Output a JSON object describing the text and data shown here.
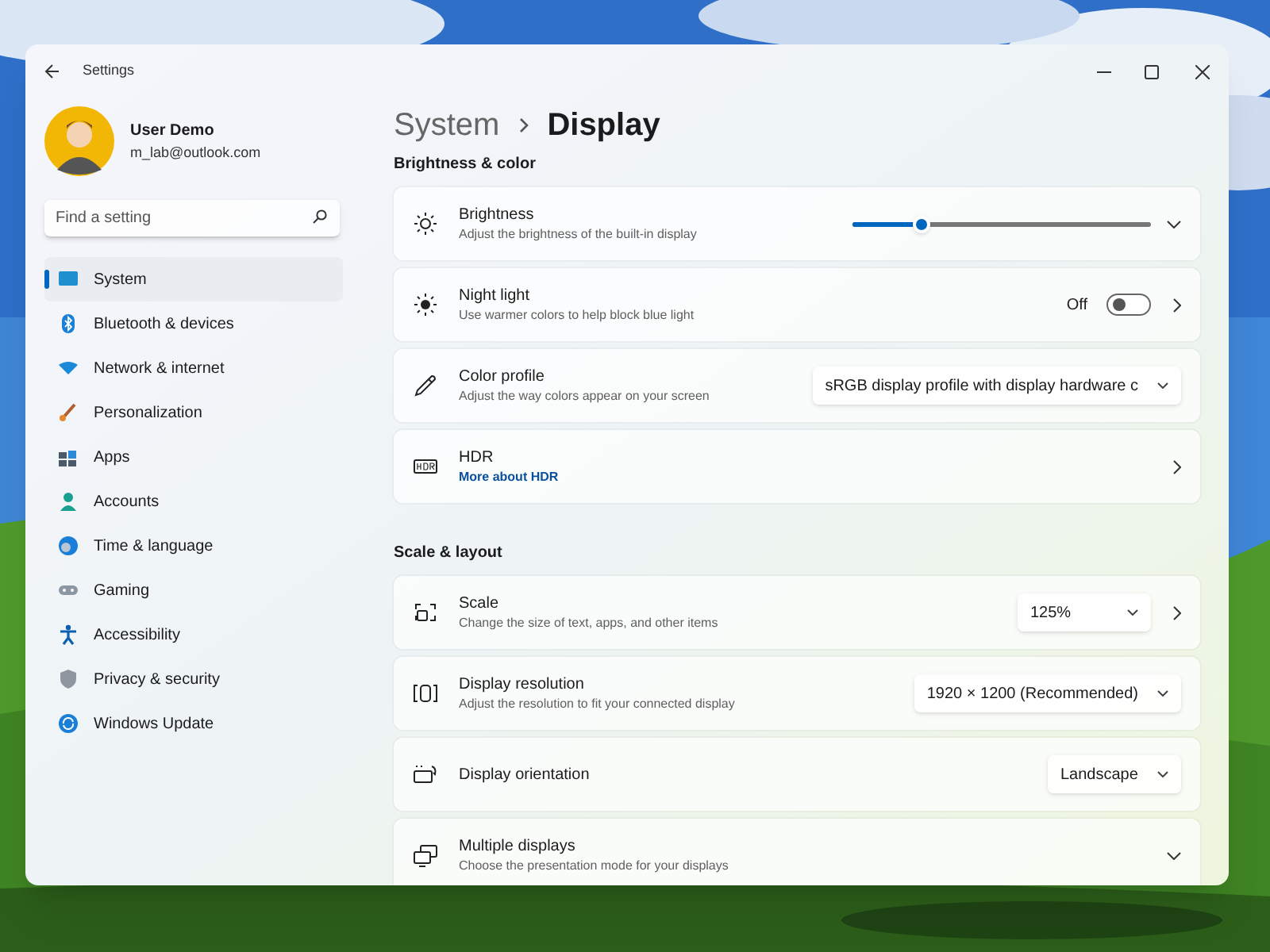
{
  "window": {
    "title": "Settings"
  },
  "account": {
    "name": "User Demo",
    "email": "m_lab@outlook.com"
  },
  "search": {
    "placeholder": "Find a setting"
  },
  "nav": [
    {
      "label": "System",
      "selected": true
    },
    {
      "label": "Bluetooth & devices",
      "selected": false
    },
    {
      "label": "Network & internet",
      "selected": false
    },
    {
      "label": "Personalization",
      "selected": false
    },
    {
      "label": "Apps",
      "selected": false
    },
    {
      "label": "Accounts",
      "selected": false
    },
    {
      "label": "Time & language",
      "selected": false
    },
    {
      "label": "Gaming",
      "selected": false
    },
    {
      "label": "Accessibility",
      "selected": false
    },
    {
      "label": "Privacy & security",
      "selected": false
    },
    {
      "label": "Windows Update",
      "selected": false
    }
  ],
  "breadcrumb": {
    "parent": "System",
    "current": "Display"
  },
  "sections": [
    {
      "title": "Brightness & color",
      "rows": [
        {
          "kind": "slider",
          "title": "Brightness",
          "subtitle": "Adjust the brightness of the built-in display",
          "level": 0.23,
          "expanded": false
        },
        {
          "kind": "toggle",
          "title": "Night light",
          "subtitle": "Use warmer colors to help block blue light",
          "on": false,
          "state_label": "Off",
          "opens_page": true
        },
        {
          "kind": "dropdown",
          "title": "Color profile",
          "subtitle": "Adjust the way colors appear on your screen",
          "value": "sRGB display profile with display hardware c"
        },
        {
          "kind": "plain",
          "title": "HDR",
          "link": "More about HDR",
          "opens_page": true
        }
      ]
    },
    {
      "title": "Scale & layout",
      "rows": [
        {
          "kind": "dropdown",
          "title": "Scale",
          "subtitle": "Change the size of text, apps, and other items",
          "value": "125%",
          "opens_page": true
        },
        {
          "kind": "dropdown",
          "title": "Display resolution",
          "subtitle": "Adjust the resolution to fit your connected display",
          "value": "1920 × 1200 (Recommended)"
        },
        {
          "kind": "dropdown",
          "title": "Display orientation",
          "value": "Landscape"
        },
        {
          "kind": "plain",
          "title": "Multiple displays",
          "subtitle": "Choose the presentation mode for your displays",
          "expanded": false
        }
      ]
    }
  ]
}
